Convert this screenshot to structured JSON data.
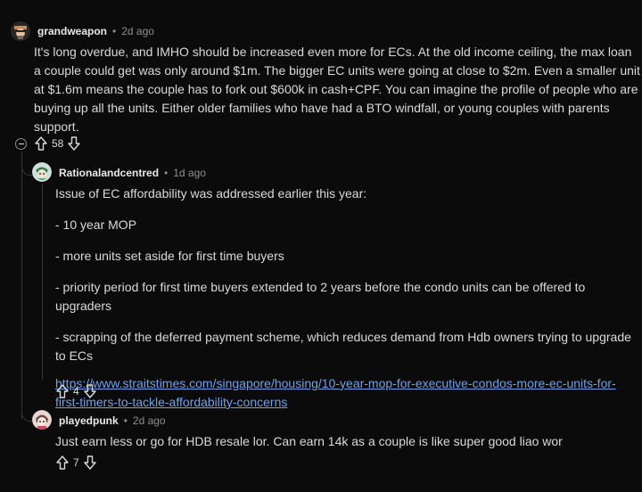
{
  "comments": [
    {
      "username": "grandweapon",
      "separator": "•",
      "time": "2d ago",
      "lines": [
        "It's long overdue, and IMHO should be increased even more for ECs. At the old income ceiling, the max loan",
        "a couple could get was only around $1m. The bigger EC units were going at close to $2m. Even a smaller unit",
        "at $1.6m means the couple has to fork out $600k in cash+CPF. You can imagine the profile of people who are",
        "buying up all the units. Either older families who have had a BTO windfall, or young couples with parents",
        "support."
      ],
      "votes": "58"
    },
    {
      "username": "Rationalandcentred",
      "separator": "•",
      "time": "1d ago",
      "intro": "Issue of EC affordability was addressed earlier this year:",
      "points": [
        "- 10 year MOP",
        "- more units set aside for first time buyers",
        "- priority period for first time buyers extended to 2 years before the condo units can be offered to",
        "upgraders",
        "- scrapping of the deferred payment scheme, which reduces demand from Hdb owners trying to upgrade",
        "to ECs"
      ],
      "link_lines": [
        "https://www.straitstimes.com/singapore/housing/10-year-mop-for-executive-condos-more-ec-units-for-",
        "first-timers-to-tackle-affordability-concerns"
      ],
      "votes": "4"
    },
    {
      "username": "playedpunk",
      "separator": "•",
      "time": "2d ago",
      "text": "Just earn less or go for HDB resale lor. Can earn 14k as a couple is like super good liao wor",
      "votes": "7"
    }
  ],
  "colors": {
    "background": "#0b0b0b",
    "text": "#d7dadc",
    "link": "#6fa0e8",
    "meta": "#8f8f8f"
  },
  "icons": [
    "avatar",
    "collapse-icon",
    "upvote-icon",
    "downvote-icon"
  ]
}
